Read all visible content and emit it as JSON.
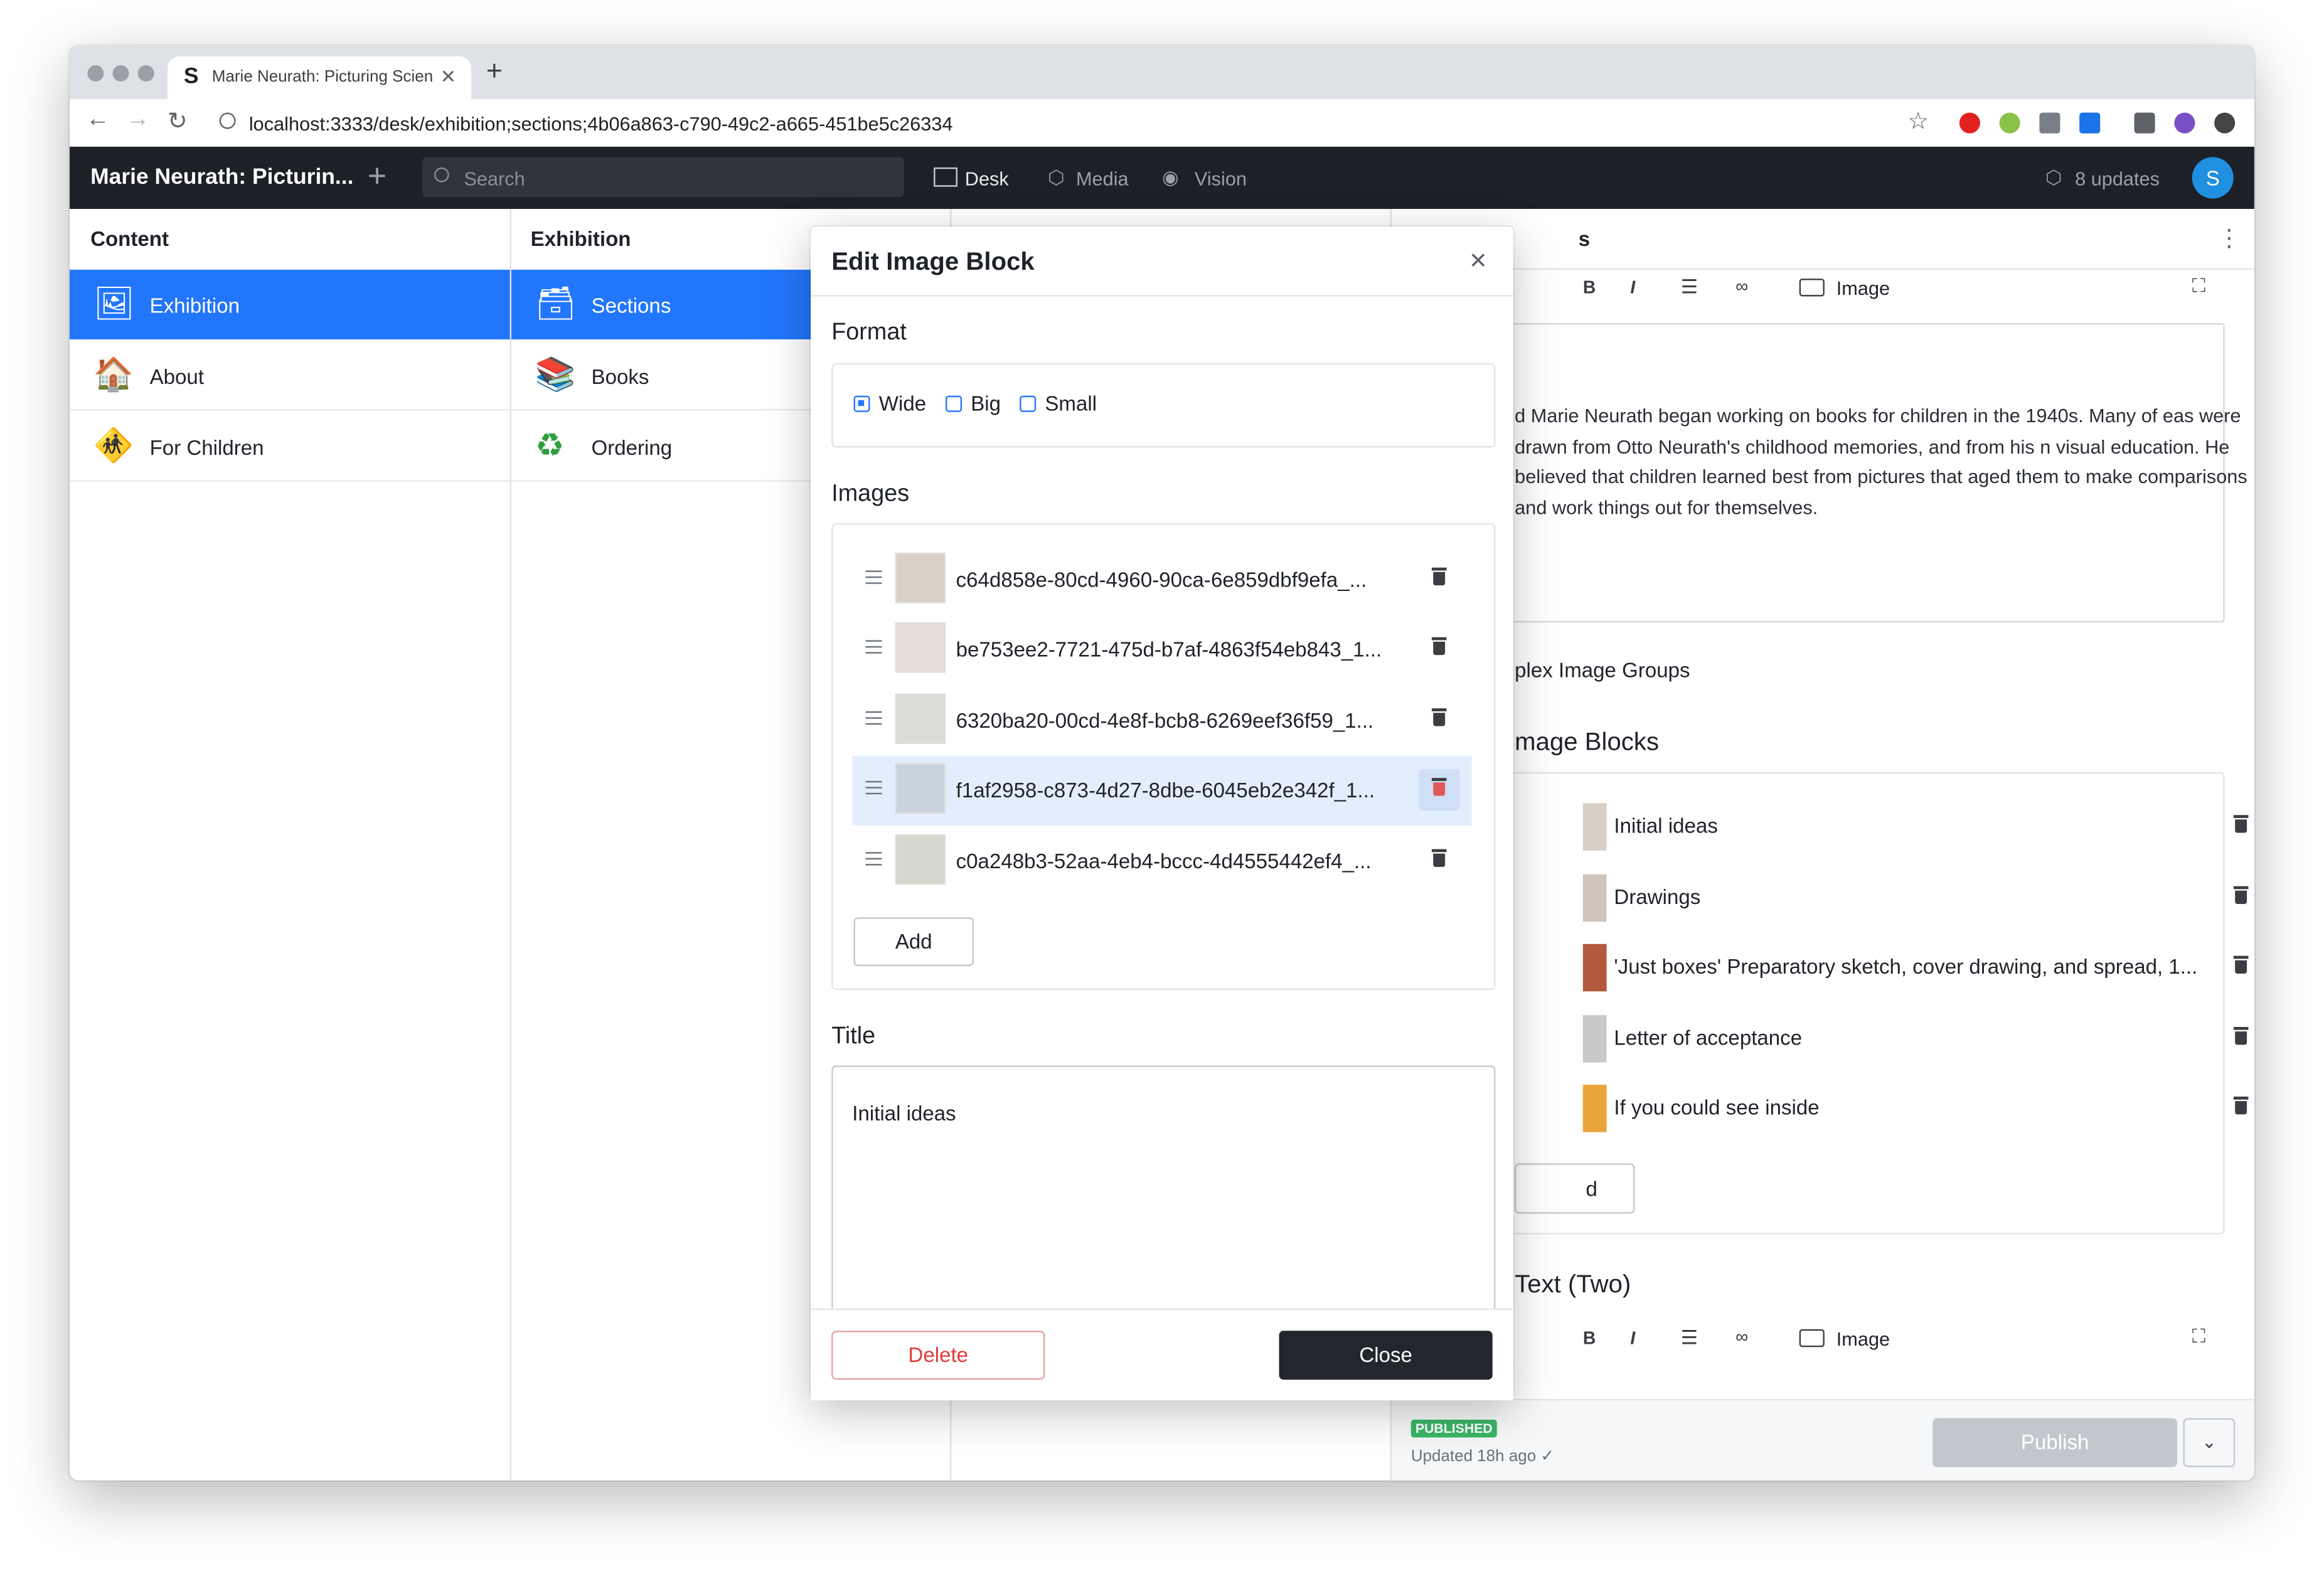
{
  "browser": {
    "tab_title": "Marie Neurath: Picturing Scien",
    "tab_favicon": "S",
    "url": "localhost:3333/desk/exhibition;sections;4b06a863-c790-49c2-a665-451be5c26334"
  },
  "app": {
    "title": "Marie Neurath: Picturin...",
    "search_placeholder": "Search",
    "nav": [
      "Desk",
      "Media",
      "Vision"
    ],
    "updates": "8 updates",
    "avatar": "S"
  },
  "content_pane": {
    "heading": "Content",
    "items": [
      {
        "label": "Exhibition",
        "icon": "framed-picture-icon",
        "active": true
      },
      {
        "label": "About",
        "icon": "house-icon",
        "active": false
      },
      {
        "label": "For Children",
        "icon": "children-crossing-icon",
        "active": false
      }
    ]
  },
  "exhibition_pane": {
    "heading": "Exhibition",
    "items": [
      {
        "label": "Sections",
        "icon": "card-box-icon",
        "active": true
      },
      {
        "label": "Books",
        "icon": "books-icon",
        "active": false
      },
      {
        "label": "Ordering",
        "icon": "recycle-icon",
        "active": false
      }
    ]
  },
  "document": {
    "header_fragment": "s",
    "toolbar": {
      "image_label": "Image"
    },
    "body_text": "d Marie Neurath began working on books for children in the 1940s. Many of eas were drawn from Otto Neurath's childhood memories, and from his n visual education. He believed that children learned best from pictures that aged them to make comparisons and work things out for themselves.",
    "complex_groups_label": "plex Image Groups",
    "image_blocks_heading": "mage Blocks",
    "image_blocks": [
      "Initial ideas",
      "Drawings",
      "'Just boxes' Preparatory sketch, cover drawing, and spread, 1...",
      "Letter of acceptance",
      "If you could see inside"
    ],
    "add_fragment": "d",
    "text_two_heading": "Text (Two)",
    "status_badge": "PUBLISHED",
    "updated": "Updated 18h ago ✓",
    "publish_label": "Publish"
  },
  "modal": {
    "title": "Edit Image Block",
    "format_label": "Format",
    "format_options": [
      {
        "label": "Wide",
        "checked": true
      },
      {
        "label": "Big",
        "checked": false
      },
      {
        "label": "Small",
        "checked": false
      }
    ],
    "images_label": "Images",
    "images": [
      "c64d858e-80cd-4960-90ca-6e859dbf9efa_...",
      "be753ee2-7721-475d-b7af-4863f54eb843_1...",
      "6320ba20-00cd-4e8f-bcb8-6269eef36f59_1...",
      "f1af2958-c873-4d27-8dbe-6045eb2e342f_1...",
      "c0a248b3-52aa-4eb4-bccc-4d4555442ef4_..."
    ],
    "add_label": "Add",
    "title_label": "Title",
    "title_value": "Initial ideas",
    "delete_label": "Delete",
    "close_label": "Close"
  },
  "colors": {
    "accent": "#2276fc",
    "app_bar": "#1d2027",
    "danger": "#e03b3b",
    "published": "#3ab667"
  }
}
